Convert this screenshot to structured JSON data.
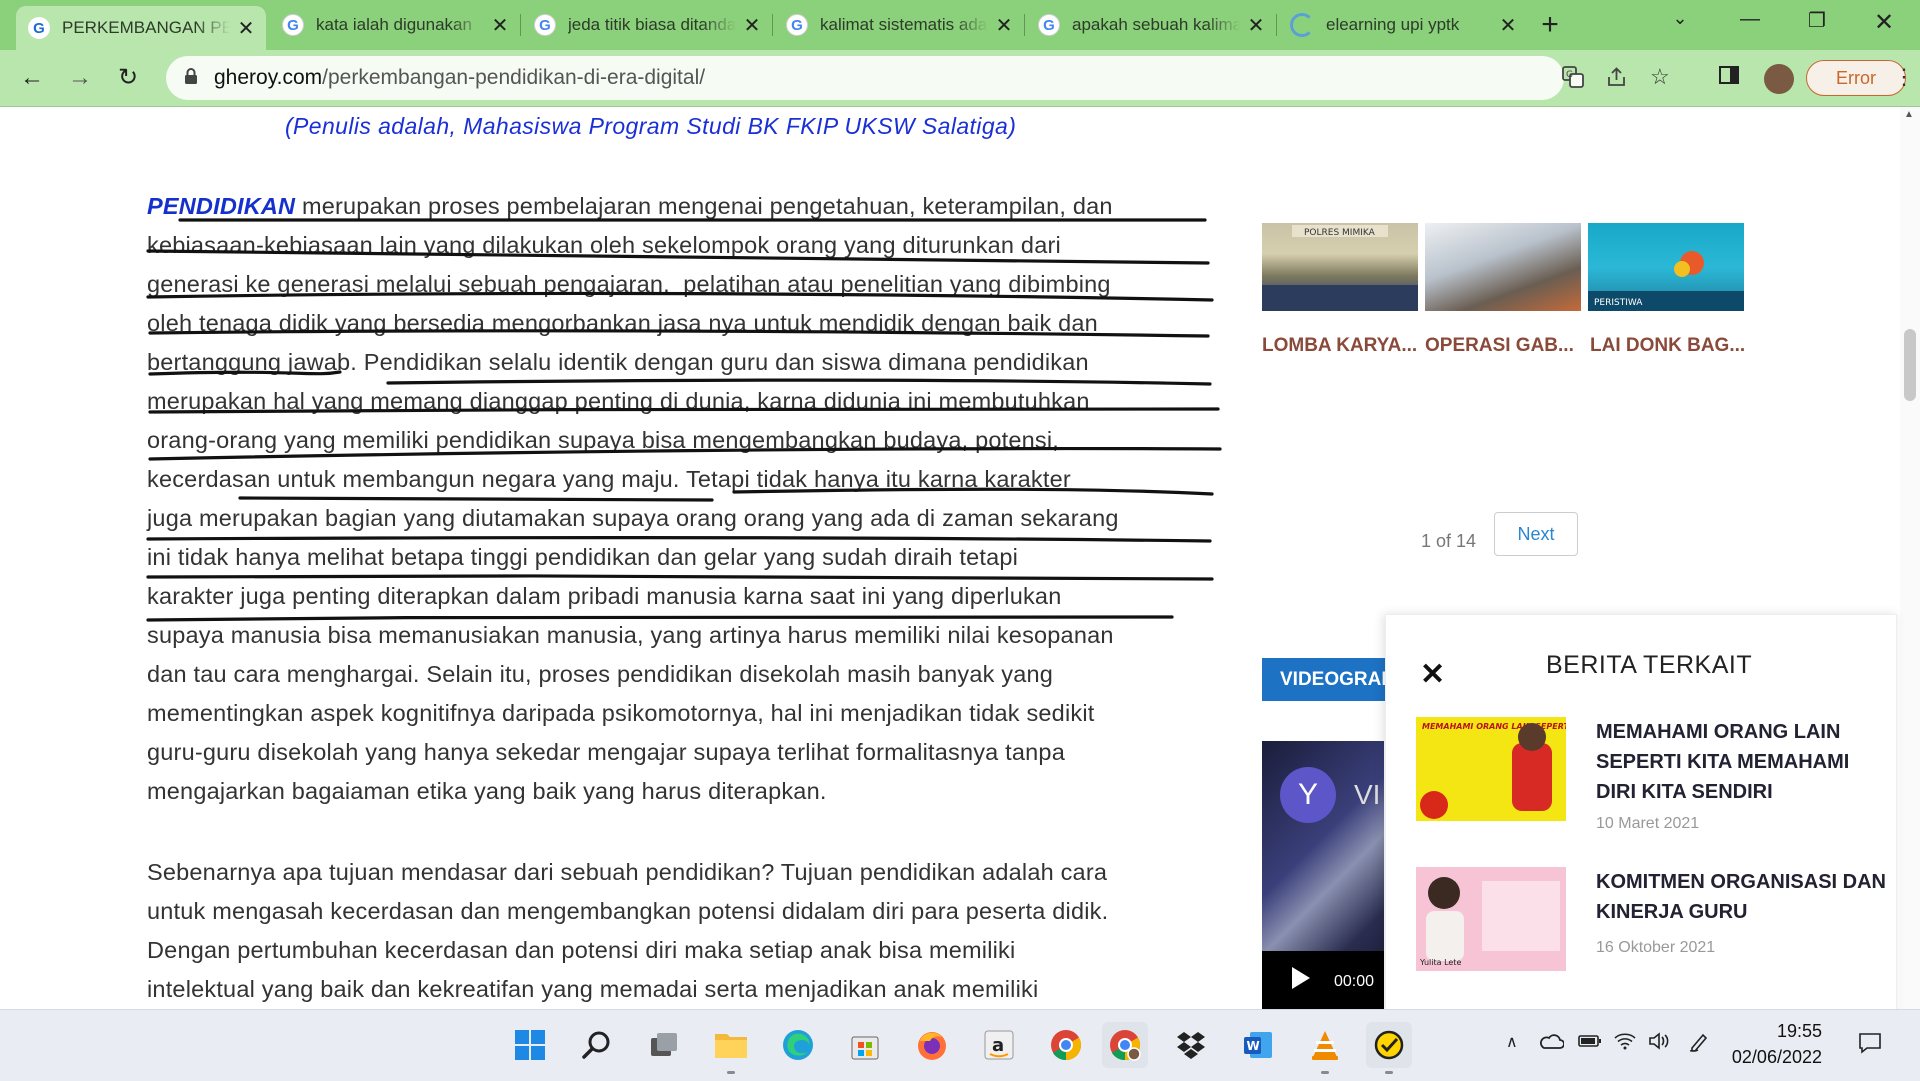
{
  "browser": {
    "tabs": [
      {
        "title": "PERKEMBANGAN PENDIDIKAN DI ERA DIGITAL",
        "icon": "gheroy-favicon",
        "active": true
      },
      {
        "title": "kata ialah digunakan",
        "icon": "google-icon"
      },
      {
        "title": "jeda titik biasa ditandai",
        "icon": "google-icon"
      },
      {
        "title": "kalimat sistematis adalah",
        "icon": "google-icon"
      },
      {
        "title": "apakah sebuah kalimat",
        "icon": "google-icon"
      },
      {
        "title": "elearning upi yptk",
        "icon": "loading-spinner-icon"
      }
    ],
    "url_domain": "gheroy.com",
    "url_path": "/perkembangan-pendidikan-di-era-digital/",
    "profile_status": "Error"
  },
  "page": {
    "author_note": "(Penulis adalah, Mahasiswa Program Studi BK FKIP UKSW Salatiga)",
    "article": {
      "lead_word": "PENDIDIKAN",
      "paragraph1_lines": [
        " merupakan proses pembelajaran mengenai pengetahuan, keterampilan, dan",
        "kebiasaan-kebiasaan lain yang dilakukan oleh sekelompok orang yang diturunkan dari",
        "generasi ke generasi melalui sebuah pengajaran,  pelatihan atau penelitian yang dibimbing",
        "oleh tenaga didik yang bersedia mengorbankan jasa nya untuk mendidik dengan baik dan",
        "bertanggung jawab. Pendidikan selalu identik dengan guru dan siswa dimana pendidikan",
        "merupakan hal yang memang dianggap penting di dunia, karna didunia ini membutuhkan",
        "orang-orang yang memiliki pendidikan supaya bisa mengembangkan budaya, potensi,",
        "kecerdasan untuk membangun negara yang maju. Tetapi tidak hanya itu karna karakter",
        "juga merupakan bagian yang diutamakan supaya orang orang yang ada di zaman sekarang",
        "ini tidak hanya melihat betapa tinggi pendidikan dan gelar yang sudah diraih tetapi",
        "karakter juga penting diterapkan dalam pribadi manusia karna saat ini yang diperlukan",
        "supaya manusia bisa memanusiakan manusia, yang artinya harus memiliki nilai kesopanan",
        "dan tau cara menghargai. Selain itu, proses pendidikan disekolah masih banyak yang",
        "mementingkan aspek kognitifnya daripada psikomotornya, hal ini menjadikan tidak sedikit",
        "guru-guru disekolah yang hanya sekedar mengajar supaya terlihat formalitasnya tanpa",
        "mengajarkan bagaiaman etika yang baik yang harus diterapkan."
      ],
      "paragraph2_lines": [
        "Sebenarnya apa tujuan mendasar dari sebuah pendidikan? Tujuan pendidikan adalah cara",
        "untuk mengasah kecerdasan dan mengembangkan potensi didalam diri para peserta didik.",
        "Dengan pertumbuhan kecerdasan dan potensi diri maka setiap anak bisa memiliki",
        "intelektual yang baik dan kekreatifan yang memadai serta menjadikan anak memiliki"
      ]
    },
    "sidebar": {
      "slider_items": [
        {
          "caption": "LOMBA KARYA...",
          "image_text": "POLRES MIMIKA"
        },
        {
          "caption": "OPERASI GAB...",
          "image_text": ""
        },
        {
          "caption": "LAI DONK BAG...",
          "image_text": "PERISTIWA"
        }
      ],
      "pager_text": "1 of 14",
      "next_label": "Next",
      "video_section_label": "VIDEOGRAFI",
      "video": {
        "logo_letter": "Y",
        "title_fragment": "VI",
        "time": "00:00"
      }
    },
    "related": {
      "title": "BERITA TERKAIT",
      "items": [
        {
          "headline": "MEMAHAMI ORANG LAIN SEPERTI KITA MEMAHAMI DIRI KITA SENDIRI",
          "date": "10 Maret 2021",
          "image_text": "MEMAHAMI ORANG LAIN SEPERTI KITA MEMAHAMI DIRI KITA SENDIRI"
        },
        {
          "headline": "KOMITMEN ORGANISASI DAN KINERJA GURU",
          "date": "16 Oktober 2021",
          "image_text": "Yulita Lete"
        }
      ]
    }
  },
  "taskbar": {
    "apps": [
      "windows-start-icon",
      "search-icon",
      "task-view-icon",
      "file-explorer-icon",
      "edge-icon",
      "microsoft-store-icon",
      "firefox-icon",
      "amazon-icon",
      "chrome-icon",
      "chrome-profile-icon",
      "dropbox-icon",
      "word-icon",
      "vlc-icon",
      "norton-icon"
    ],
    "time": "19:55",
    "date": "02/06/2022"
  },
  "colors": {
    "tab_strip": "#8bd07a",
    "toolbar": "#b9e6ac",
    "link_blue": "#1530cc",
    "accent_blue": "#1d72c4",
    "caption_brown": "#8a4a3a"
  }
}
